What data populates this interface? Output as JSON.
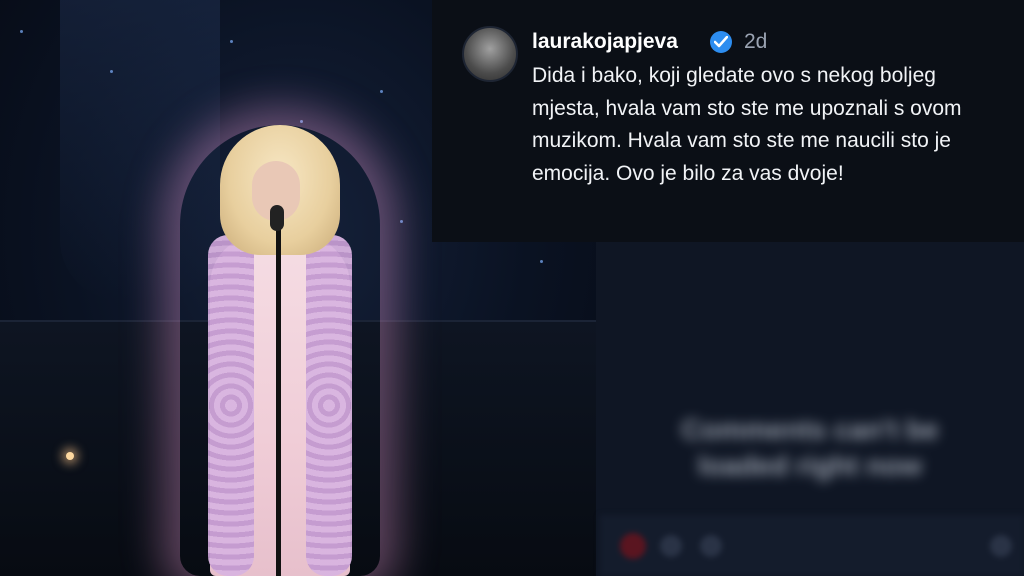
{
  "post": {
    "username": "laurakojapjeva",
    "verified_icon": "verified-badge-icon",
    "time": "2d",
    "caption": "Dida i bako, koji gledate ovo s nekog boljeg mjesta, hvala vam sto ste me upoznali s ovom muzikom. Hvala vam sto ste me naucili sto je emocija. Ovo je bilo za vas dvoje!"
  },
  "comments": {
    "disabled_message": "Comments can't be loaded right now"
  },
  "colors": {
    "background": "#0b0f18",
    "verified": "#2d8df0",
    "text": "#f1f3f6",
    "muted": "#9aa3b2"
  }
}
